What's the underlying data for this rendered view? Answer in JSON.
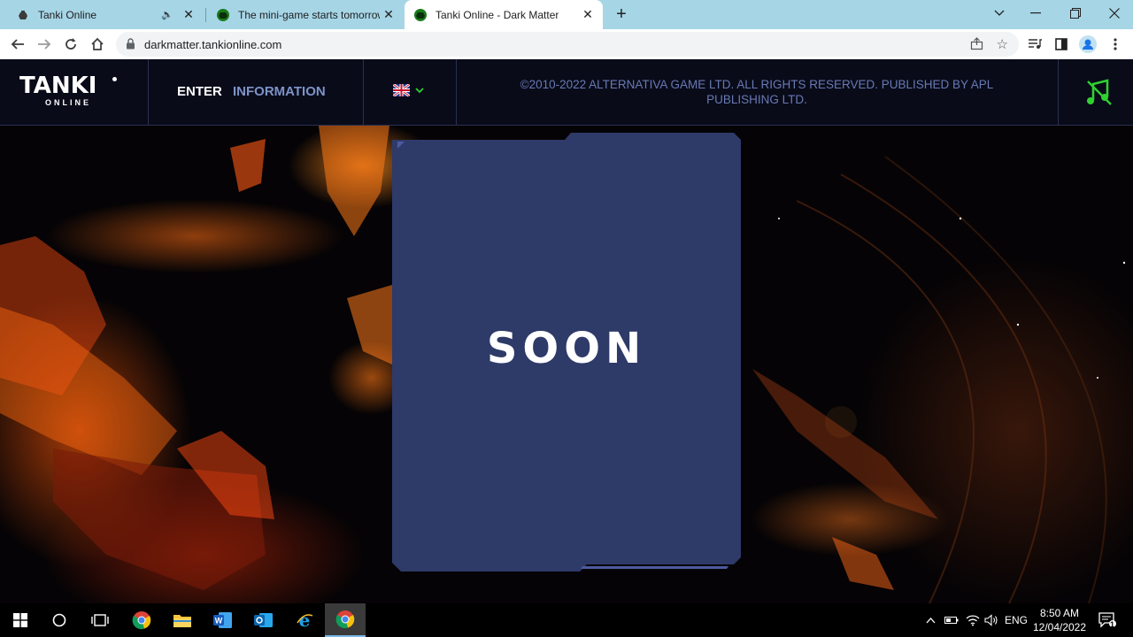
{
  "browser": {
    "tabs": [
      {
        "title": "Tanki Online",
        "favicon": "tanki-favicon-icon"
      },
      {
        "title": "The mini-game starts tomorrow!",
        "favicon": "tanki-favicon-icon",
        "muted": true
      },
      {
        "title": "Tanki Online - Dark Matter",
        "favicon": "tanki-favicon-icon",
        "active": true
      }
    ],
    "url": "darkmatter.tankionline.com"
  },
  "site": {
    "logo_main": "TANKI",
    "logo_sub": "ONLINE",
    "nav": {
      "enter": "ENTER",
      "information": "INFORMATION"
    },
    "copyright": "©2010-2022 ALTERNATIVA GAME LTD. ALL RIGHTS RESERVED. PUBLISHED BY APL PUBLISHING LTD.",
    "card_text": "SOON",
    "colors": {
      "header_bg": "#0a0c1c",
      "card_bg": "#2e3a68",
      "nav_inactive": "#7d93c8",
      "accent_green": "#2fd12f"
    }
  },
  "taskbar": {
    "language": "ENG",
    "time": "8:50 AM",
    "date": "12/04/2022",
    "notification_count": "1"
  }
}
